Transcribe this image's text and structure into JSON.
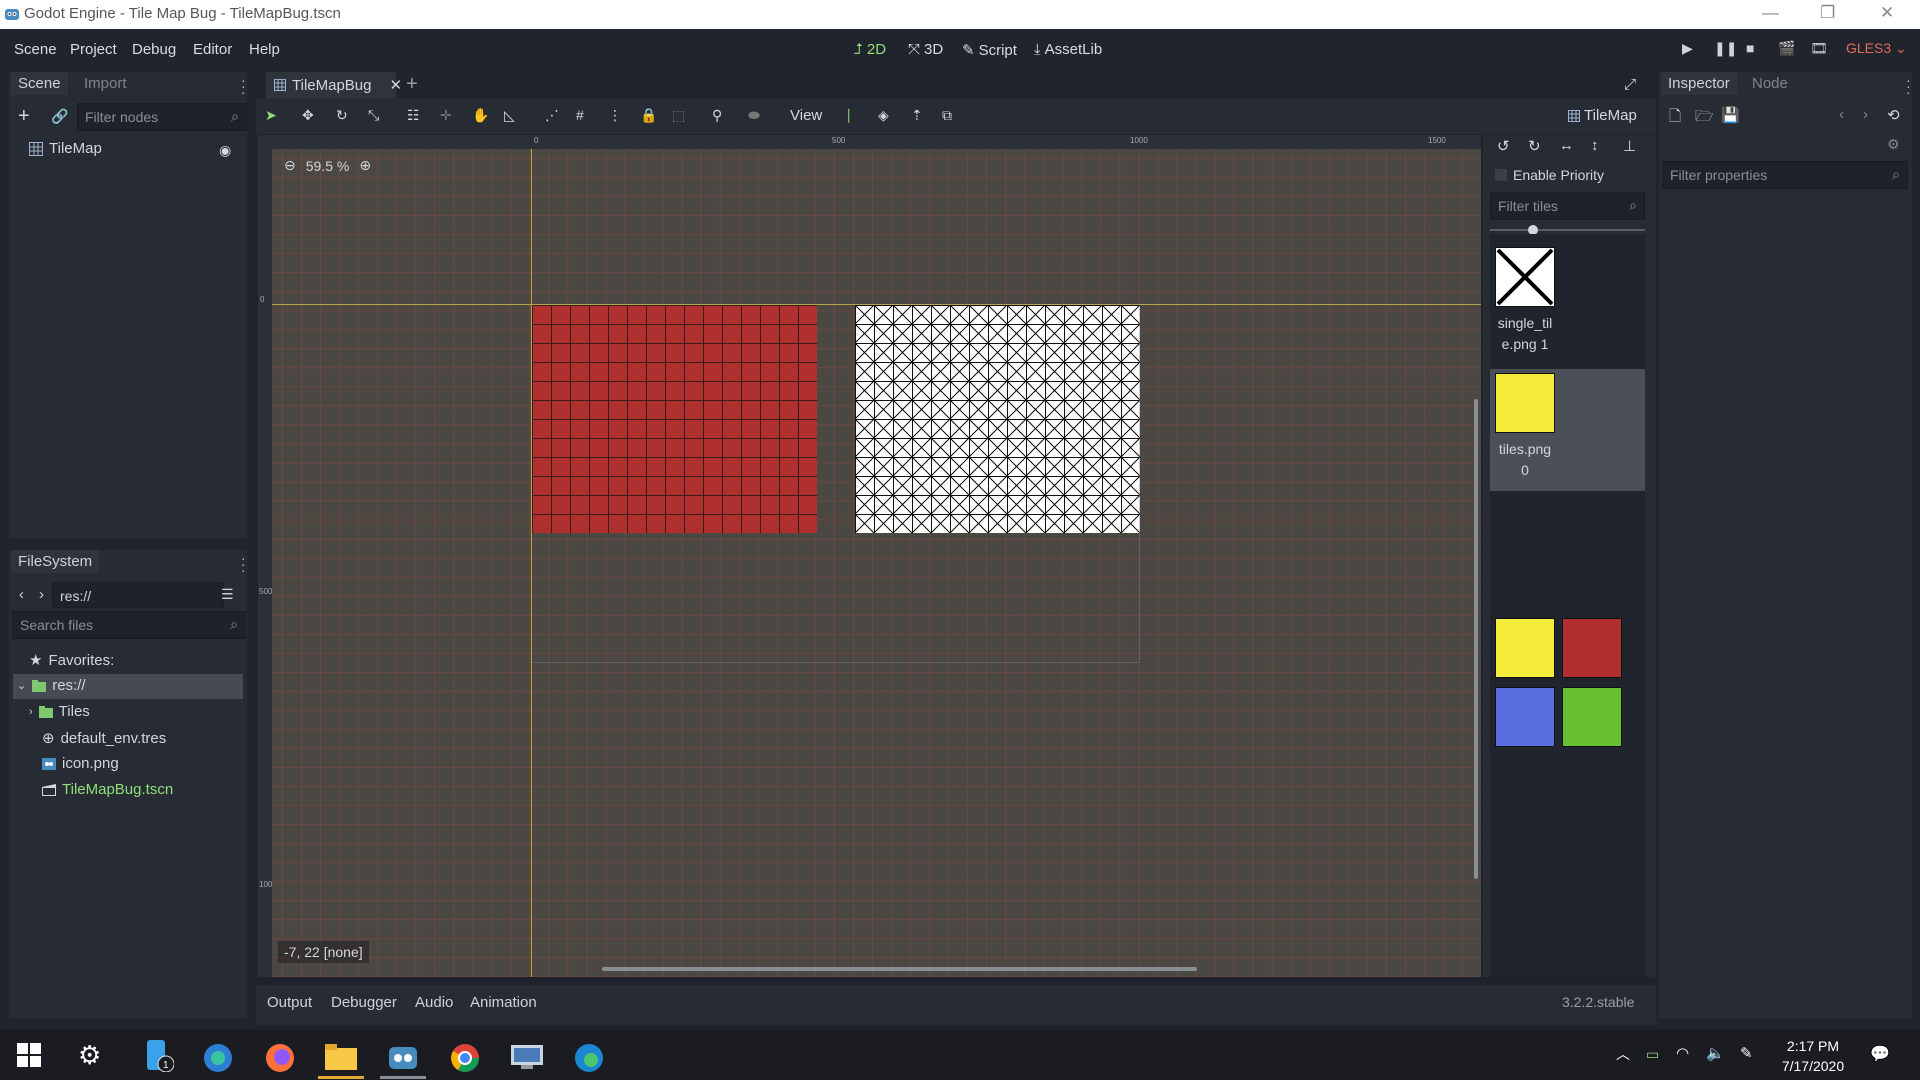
{
  "window": {
    "title": "Godot Engine - Tile Map Bug - TileMapBug.tscn"
  },
  "menu": {
    "scene": "Scene",
    "project": "Project",
    "debug": "Debug",
    "editor": "Editor",
    "help": "Help"
  },
  "workspaces": {
    "w2d": "2D",
    "w3d": "3D",
    "script": "Script",
    "assetlib": "AssetLib"
  },
  "renderer": "GLES3",
  "scene_dock": {
    "tab_scene": "Scene",
    "tab_import": "Import",
    "filter_placeholder": "Filter nodes",
    "tree": [
      {
        "label": "TileMap"
      }
    ]
  },
  "filesystem_dock": {
    "title": "FileSystem",
    "path": "res://",
    "search_placeholder": "Search files",
    "favorites": "Favorites:",
    "root": "res://",
    "items": [
      {
        "label": "Tiles",
        "icon": "folder-icon"
      },
      {
        "label": "default_env.tres",
        "icon": "globe-icon"
      },
      {
        "label": "icon.png",
        "icon": "image-icon"
      },
      {
        "label": "TileMapBug.tscn",
        "icon": "scene-icon"
      }
    ]
  },
  "editor": {
    "scene_tab": "TileMapBug",
    "view_menu": "View",
    "zoom": "59.5 %",
    "ruler_top": [
      "0",
      "500",
      "1000",
      "1500"
    ],
    "ruler_left": [
      "0",
      "500",
      "1000"
    ],
    "cursor_status": "-7, 22 [none]",
    "node_label": "TileMap"
  },
  "tile_palette": {
    "enable_priority": "Enable Priority",
    "filter_placeholder": "Filter tiles",
    "tiles": [
      {
        "name_line1": "single_til",
        "name_line2": "e.png 1"
      },
      {
        "name_line1": "tiles.png",
        "name_line2": "0"
      }
    ],
    "swatch_colors": [
      "#f5ec3a",
      "#b03030",
      "#5a6ee0",
      "#66c02f"
    ]
  },
  "bottom_panel": {
    "output": "Output",
    "debugger": "Debugger",
    "audio": "Audio",
    "animation": "Animation",
    "version": "3.2.2.stable"
  },
  "inspector": {
    "tab_inspector": "Inspector",
    "tab_node": "Node",
    "filter_placeholder": "Filter properties"
  },
  "taskbar": {
    "time": "2:17 PM",
    "date": "7/17/2020"
  },
  "colors": {
    "accent_green": "#8fe07a",
    "red_tile": "#b03030",
    "yellow_tile": "#f5ec3a"
  }
}
